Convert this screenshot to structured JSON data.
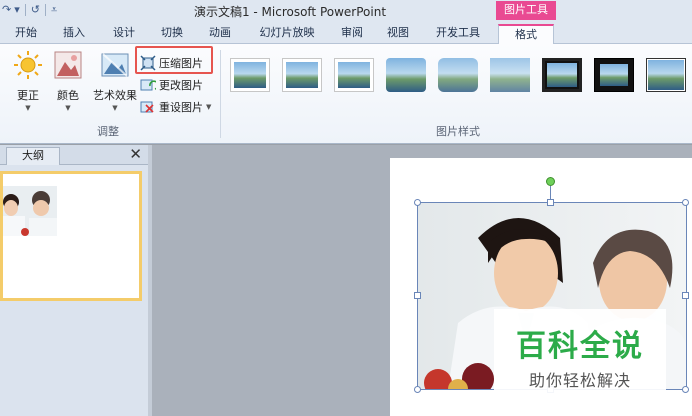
{
  "title_bar": {
    "title": "演示文稿1 - Microsoft PowerPoint",
    "context_tab": "图片工具"
  },
  "tabs": [
    "开始",
    "插入",
    "设计",
    "切换",
    "动画",
    "幻灯片放映",
    "审阅",
    "视图",
    "开发工具",
    "格式"
  ],
  "active_tab": "格式",
  "ribbon": {
    "adjust_group": {
      "label": "调整",
      "corrections": "更正",
      "color": "颜色",
      "artistic_effects": "艺术效果",
      "compress": "压缩图片",
      "change": "更改图片",
      "reset": "重设图片"
    },
    "styles_group": {
      "label": "图片样式"
    }
  },
  "panel": {
    "outline_tab": "大纲"
  },
  "watermark": {
    "title": "百科全说",
    "subtitle": "助你轻松解决"
  },
  "colors": {
    "accent": "#e94a92",
    "highlight": "#e6554f",
    "watermark_green": "#2cab49"
  }
}
